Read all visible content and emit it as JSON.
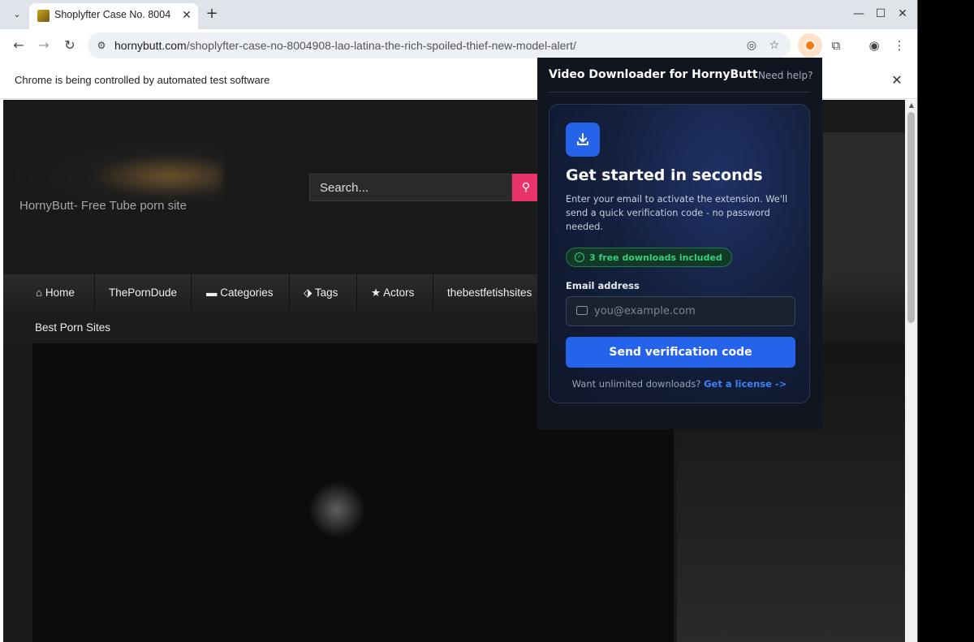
{
  "browser": {
    "tab_title": "Shoplyfter Case No. 8004",
    "url_host": "hornybutt.com",
    "url_path": "/shoplyfter-case-no-8004908-lao-latina-the-rich-spoiled-thief-new-model-alert/",
    "infobar_text": "Chrome is being controlled by automated test software"
  },
  "site": {
    "name": "HornyButt- Free Tube porn site",
    "search_placeholder": "Search...",
    "nav": [
      {
        "label": "Home",
        "icon": "home-icon"
      },
      {
        "label": "ThePornDude"
      },
      {
        "label": "Categories",
        "icon": "folder-icon"
      },
      {
        "label": "Tags",
        "icon": "tags-icon"
      },
      {
        "label": "Actors",
        "icon": "star-icon"
      },
      {
        "label": "thebestfetishsites"
      },
      {
        "label": "Best Porn Sites"
      }
    ]
  },
  "popup": {
    "title": "Video Downloader for HornyButt",
    "help": "Need help?",
    "heading": "Get started in seconds",
    "description": "Enter your email to activate the extension. We'll send a quick verification code - no password needed.",
    "badge": "3 free downloads included",
    "email_label": "Email address",
    "email_placeholder": "you@example.com",
    "send_button": "Send verification code",
    "footer_text": "Want unlimited downloads?",
    "footer_link": "Get a license ->"
  },
  "colors": {
    "accent": "#2563eb",
    "badge_green": "#34d07a",
    "search_button": "#e8336b"
  }
}
